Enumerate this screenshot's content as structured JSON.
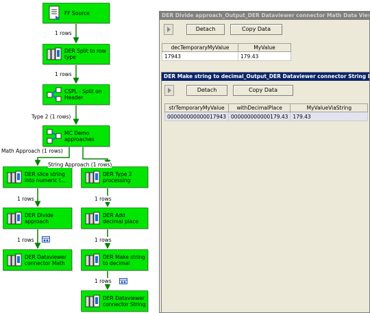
{
  "nodes": [
    {
      "id": "ff-source",
      "label": "FF Source",
      "icon": "flat-file-source-icon"
    },
    {
      "id": "der-split",
      "label": "DER Split to row\ntype",
      "icon": "derived-column-icon"
    },
    {
      "id": "cspl-split",
      "label": "CSPL - Split on\nHeader",
      "icon": "conditional-split-icon"
    },
    {
      "id": "mc-demo",
      "label": "MC Demo\napproaches",
      "icon": "multicast-icon"
    },
    {
      "id": "der-slice",
      "label": "DER slice string\ninto numeric t...",
      "icon": "derived-column-icon"
    },
    {
      "id": "der-type2",
      "label": "DER Type 2\nprocessing",
      "icon": "derived-column-icon"
    },
    {
      "id": "der-divide",
      "label": "DER Divide\napproach",
      "icon": "derived-column-icon"
    },
    {
      "id": "der-add",
      "label": "DER Add\ndecimal place",
      "icon": "derived-column-icon"
    },
    {
      "id": "der-dv-math",
      "label": "DER Dataviewer\nconnector Math",
      "icon": "derived-column-icon"
    },
    {
      "id": "der-make",
      "label": "DER Make string\nto decimal",
      "icon": "derived-column-icon"
    },
    {
      "id": "der-dv-string",
      "label": "DER Dataviewer\nconnector String",
      "icon": "derived-column-icon"
    }
  ],
  "flow_labels": {
    "f1": "1 rows",
    "f2": "1 rows",
    "f3": "Type 2 (1 rows)",
    "f4": "Math Approach (1 rows)",
    "f5": "String Approach (1 rows)",
    "f6": "1 rows",
    "f7": "1 rows",
    "f8": "1 rows",
    "f9": "1 rows",
    "f10": "1 rows"
  },
  "viewer_math": {
    "title": "DER Divide approach_Output_DER Dataviewer connector Math Data Viewer",
    "detach": "Detach",
    "copy": "Copy Data",
    "columns": [
      "decTemporaryMyValue",
      "MyValue"
    ],
    "rows": [
      [
        "17943",
        "179.43"
      ]
    ]
  },
  "viewer_string": {
    "title": "DER Make string to decimal_Output_DER Dataviewer connector String Data Viewer",
    "detach": "Detach",
    "copy": "Copy Data",
    "columns": [
      "strTemporaryMyValue",
      "withDecimalPlace",
      "MyValueViaString"
    ],
    "rows": [
      [
        "000000000000017943",
        "000000000000179.43",
        "179.43"
      ]
    ]
  },
  "colors": {
    "node_fill": "#00e600",
    "connector": "#008000",
    "title_active": "#0a246a",
    "title_inactive": "#7f7f7f"
  }
}
